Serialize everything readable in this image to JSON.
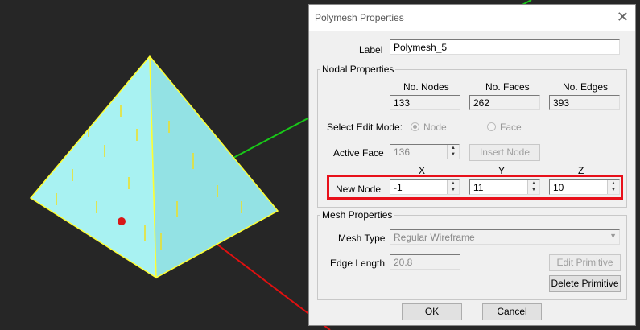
{
  "dialog": {
    "title": "Polymesh Properties",
    "close_icon": "close-icon",
    "label_caption": "Label",
    "label_value": "Polymesh_5",
    "nodal": {
      "group_title": "Nodal Properties",
      "nodes_header": "No. Nodes",
      "faces_header": "No. Faces",
      "edges_header": "No. Edges",
      "nodes": "133",
      "faces": "262",
      "edges": "393",
      "edit_mode_label": "Select Edit Mode:",
      "mode_node": "Node",
      "mode_face": "Face",
      "active_face_label": "Active Face",
      "active_face": "136",
      "insert_node": "Insert Node",
      "x_header": "X",
      "y_header": "Y",
      "z_header": "Z",
      "new_node_label": "New Node",
      "x": "-1",
      "y": "11",
      "z": "10"
    },
    "mesh": {
      "group_title": "Mesh Properties",
      "mesh_type_label": "Mesh Type",
      "mesh_type": "Regular Wireframe",
      "edge_length_label": "Edge Length",
      "edge_length": "20.8",
      "edit_primitive": "Edit Primitive",
      "delete_primitive": "Delete Primitive"
    },
    "ok": "OK",
    "cancel": "Cancel"
  },
  "colors": {
    "highlight": "#e8101a",
    "mesh": "#a6f2f2",
    "edges": "#ffff00"
  }
}
